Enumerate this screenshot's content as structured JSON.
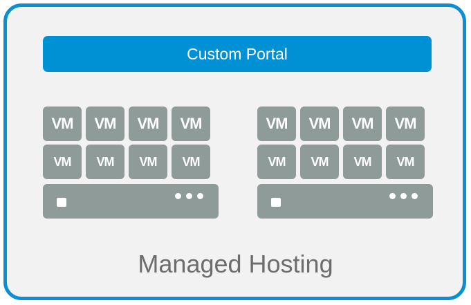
{
  "diagram": {
    "portal_label": "Custom Portal",
    "caption": "Managed Hosting",
    "vm_label": "VM",
    "colors": {
      "border": "#0b8fd3",
      "portal": "#0090d4",
      "background": "#f2f2f2",
      "server": "#8f9b99",
      "caption_text": "#6c6c6c"
    },
    "clusters": [
      {
        "name": "left",
        "vm_rows": [
          [
            "VM",
            "VM",
            "VM",
            "VM"
          ],
          [
            "VM",
            "VM",
            "VM",
            "VM"
          ]
        ],
        "server_icons": [
          "server-light-icon",
          "dots-icon"
        ]
      },
      {
        "name": "right",
        "vm_rows": [
          [
            "VM",
            "VM",
            "VM",
            "VM"
          ],
          [
            "VM",
            "VM",
            "VM",
            "VM"
          ]
        ],
        "server_icons": [
          "server-light-icon",
          "dots-icon"
        ]
      }
    ]
  }
}
